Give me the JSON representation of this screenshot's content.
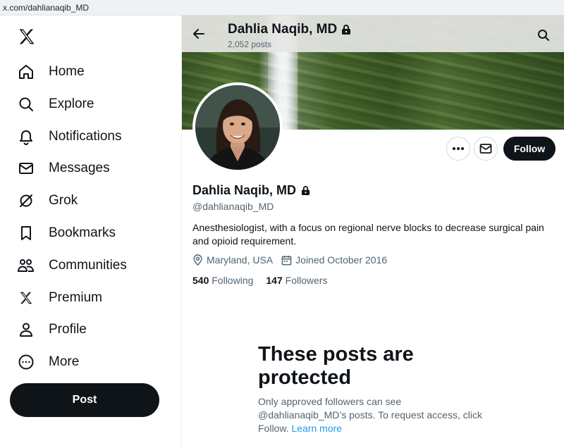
{
  "browser": {
    "url": "x.com/dahlianaqib_MD"
  },
  "sidebar": {
    "logo_icon": "x-logo-icon",
    "items": [
      {
        "label": "Home",
        "icon": "home-icon"
      },
      {
        "label": "Explore",
        "icon": "search-icon"
      },
      {
        "label": "Notifications",
        "icon": "bell-icon"
      },
      {
        "label": "Messages",
        "icon": "envelope-icon"
      },
      {
        "label": "Grok",
        "icon": "grok-icon"
      },
      {
        "label": "Bookmarks",
        "icon": "bookmark-icon"
      },
      {
        "label": "Communities",
        "icon": "people-icon"
      },
      {
        "label": "Premium",
        "icon": "x-logo-icon"
      },
      {
        "label": "Profile",
        "icon": "person-icon"
      },
      {
        "label": "More",
        "icon": "more-circle-icon"
      }
    ],
    "post_label": "Post"
  },
  "header": {
    "name": "Dahlia Naqib, MD",
    "posts_count": "2,052 posts"
  },
  "profile": {
    "name": "Dahlia Naqib, MD",
    "handle": "@dahlianaqib_MD",
    "bio": "Anesthesiologist, with a focus on regional nerve blocks to decrease surgical pain and opioid requirement.",
    "location": "Maryland, USA",
    "joined": "Joined October 2016",
    "following_count": "540",
    "following_label": "Following",
    "followers_count": "147",
    "followers_label": "Followers",
    "follow_label": "Follow",
    "protected": true
  },
  "protected_notice": {
    "title": "These posts are protected",
    "body": "Only approved followers can see @dahlianaqib_MD’s posts. To request access, click Follow.",
    "link": "Learn more"
  },
  "colors": {
    "accent": "#1d9bf0",
    "text": "#0f1419",
    "muted": "#536471",
    "button": "#0f1419"
  }
}
